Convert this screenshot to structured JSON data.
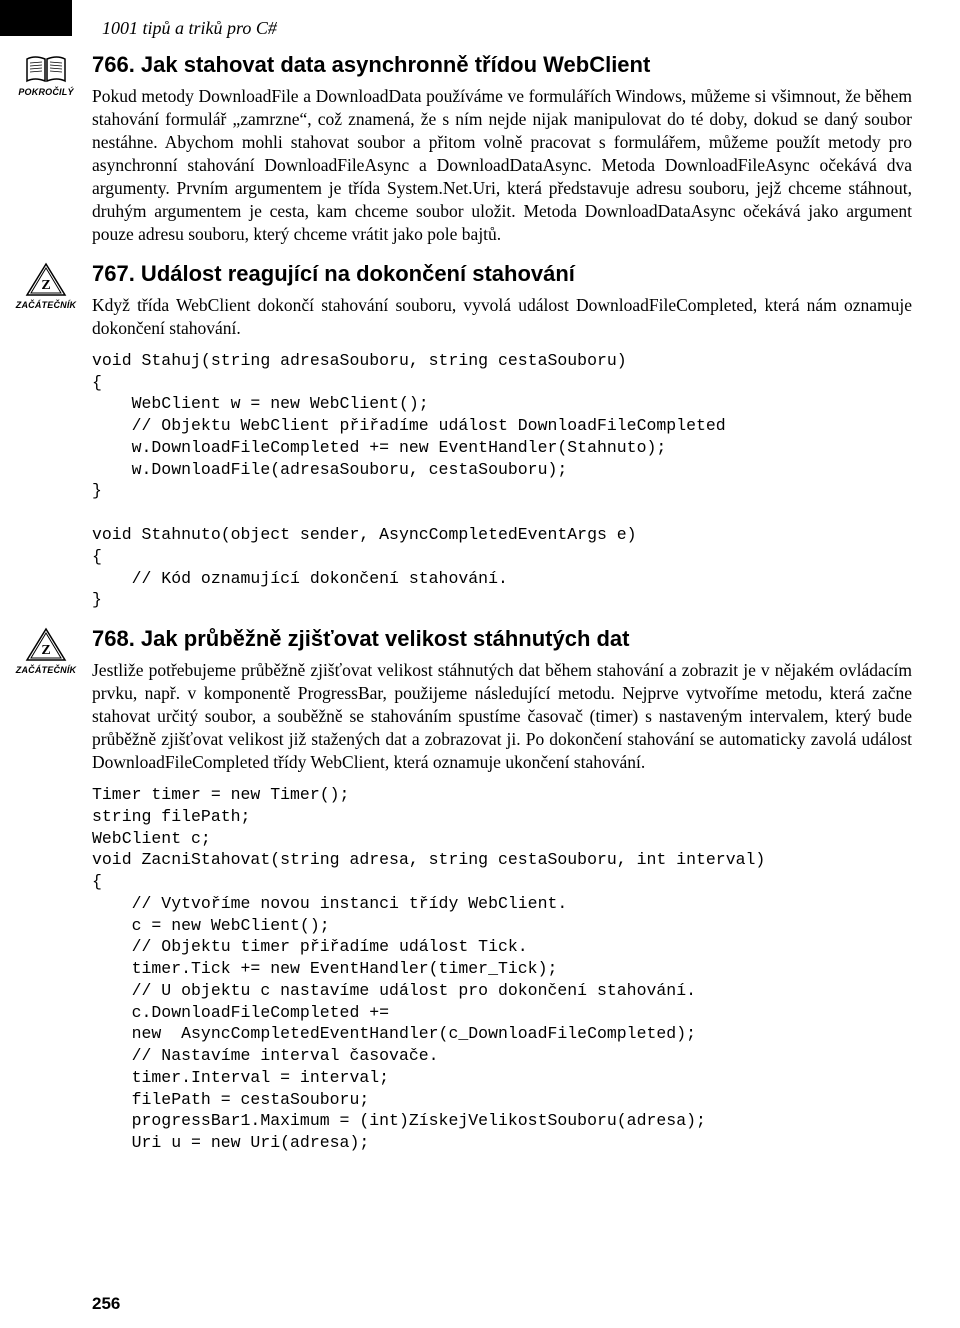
{
  "runningHead": "1001 tipů a triků pro C#",
  "iconLabels": {
    "pokrocily": "POKROČILÝ",
    "zacatecnik": "ZAČÁTEČNÍK"
  },
  "tip766": {
    "title": "766. Jak stahovat data asynchronně třídou WebClient",
    "body": "Pokud metody DownloadFile a DownloadData používáme ve formulářích Windows, můžeme si všimnout, že během stahování formulář „zamrzne“, což znamená, že s ním nejde nijak manipulovat do té doby, dokud se daný soubor nestáhne. Abychom mohli stahovat soubor a přitom  volně pracovat s formulářem, můžeme použít metody pro asynchronní stahování DownloadFileAsync a DownloadDataAsync. Metoda DownloadFileAsync očekává dva argumenty. Prvním argumentem je třída System.Net.Uri, která představuje adresu souboru, jejž chceme stáhnout, druhým argumentem je cesta, kam chceme soubor uložit. Metoda DownloadDataAsync očekává jako argument pouze adresu souboru, který chceme vrátit jako pole bajtů."
  },
  "tip767": {
    "title": "767. Událost reagující na dokončení stahování",
    "body": "Když třída WebClient dokončí stahování souboru, vyvolá událost DownloadFileCompleted, která nám oznamuje dokončení stahování.",
    "code": "void Stahuj(string adresaSouboru, string cestaSouboru)\n{\n    WebClient w = new WebClient();\n    // Objektu WebClient přiřadíme událost DownloadFileCompleted\n    w.DownloadFileCompleted += new EventHandler(Stahnuto);\n    w.DownloadFile(adresaSouboru, cestaSouboru);\n}\n\nvoid Stahnuto(object sender, AsyncCompletedEventArgs e)\n{\n    // Kód oznamující dokončení stahování.\n}"
  },
  "tip768": {
    "title": "768. Jak průběžně zjišťovat velikost stáhnutých dat",
    "body": "Jestliže potřebujeme průběžně zjišťovat velikost stáhnutých dat během stahování a zobrazit je v nějakém ovládacím prvku, např. v komponentě ProgressBar, použijeme následující metodu. Nejprve vytvoříme metodu, která  začne stahovat určitý soubor, a souběžně se stahováním spustíme časovač (timer) s nastaveným intervalem, který bude průběžně zjišťovat velikost již stažených dat a zobrazovat ji. Po dokončení stahování se automaticky zavolá událost DownloadFileCompleted třídy WebClient, která oznamuje ukončení stahování.",
    "code": "Timer timer = new Timer();\nstring filePath;\nWebClient c;\nvoid ZacniStahovat(string adresa, string cestaSouboru, int interval)\n{\n    // Vytvoříme novou instanci třídy WebClient.\n    c = new WebClient();\n    // Objektu timer přiřadíme událost Tick.\n    timer.Tick += new EventHandler(timer_Tick);\n    // U objektu c nastavíme událost pro dokončení stahování.\n    c.DownloadFileCompleted +=\n    new  AsyncCompletedEventHandler(c_DownloadFileCompleted);\n    // Nastavíme interval časovače.\n    timer.Interval = interval;\n    filePath = cestaSouboru;\n    progressBar1.Maximum = (int)ZískejVelikostSouboru(adresa);\n    Uri u = new Uri(adresa);"
  },
  "pageNumber": "256"
}
